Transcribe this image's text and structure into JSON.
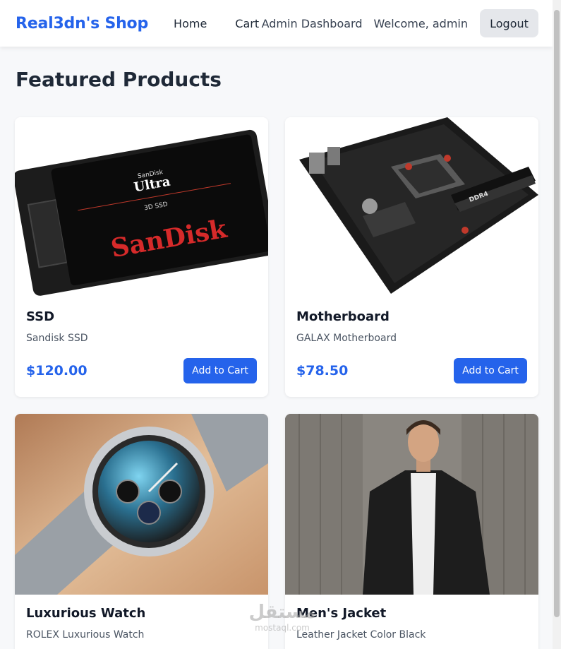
{
  "nav": {
    "brand": "Real3dn's Shop",
    "links": [
      "Home",
      "Cart"
    ],
    "admin_dashboard": "Admin Dashboard",
    "welcome": "Welcome, admin",
    "logout": "Logout"
  },
  "page_title": "Featured Products",
  "products": [
    {
      "name": "SSD",
      "description": "Sandisk SSD",
      "price": "$120.00",
      "button": "Add to Cart",
      "image_icon": "ssd-image"
    },
    {
      "name": "Motherboard",
      "description": "GALAX Motherboard",
      "price": "$78.50",
      "button": "Add to Cart",
      "image_icon": "motherboard-image"
    },
    {
      "name": "Luxurious Watch",
      "description": "ROLEX Luxurious Watch",
      "price": "",
      "button": "",
      "image_icon": "watch-image"
    },
    {
      "name": "Men's Jacket",
      "description": "Leather Jacket Color Black",
      "price": "",
      "button": "",
      "image_icon": "jacket-image"
    }
  ],
  "ssd_label": {
    "brand_small": "SanDisk",
    "line": "Ultra",
    "sub": "3D SSD",
    "logo": "SanDisk"
  },
  "mb_label": {
    "mem": "DDR4"
  },
  "watermark": {
    "ar": "مستقل",
    "en": "mostaql.com"
  },
  "colors": {
    "accent": "#2563eb",
    "background": "#f7f8fa",
    "card": "#ffffff"
  }
}
